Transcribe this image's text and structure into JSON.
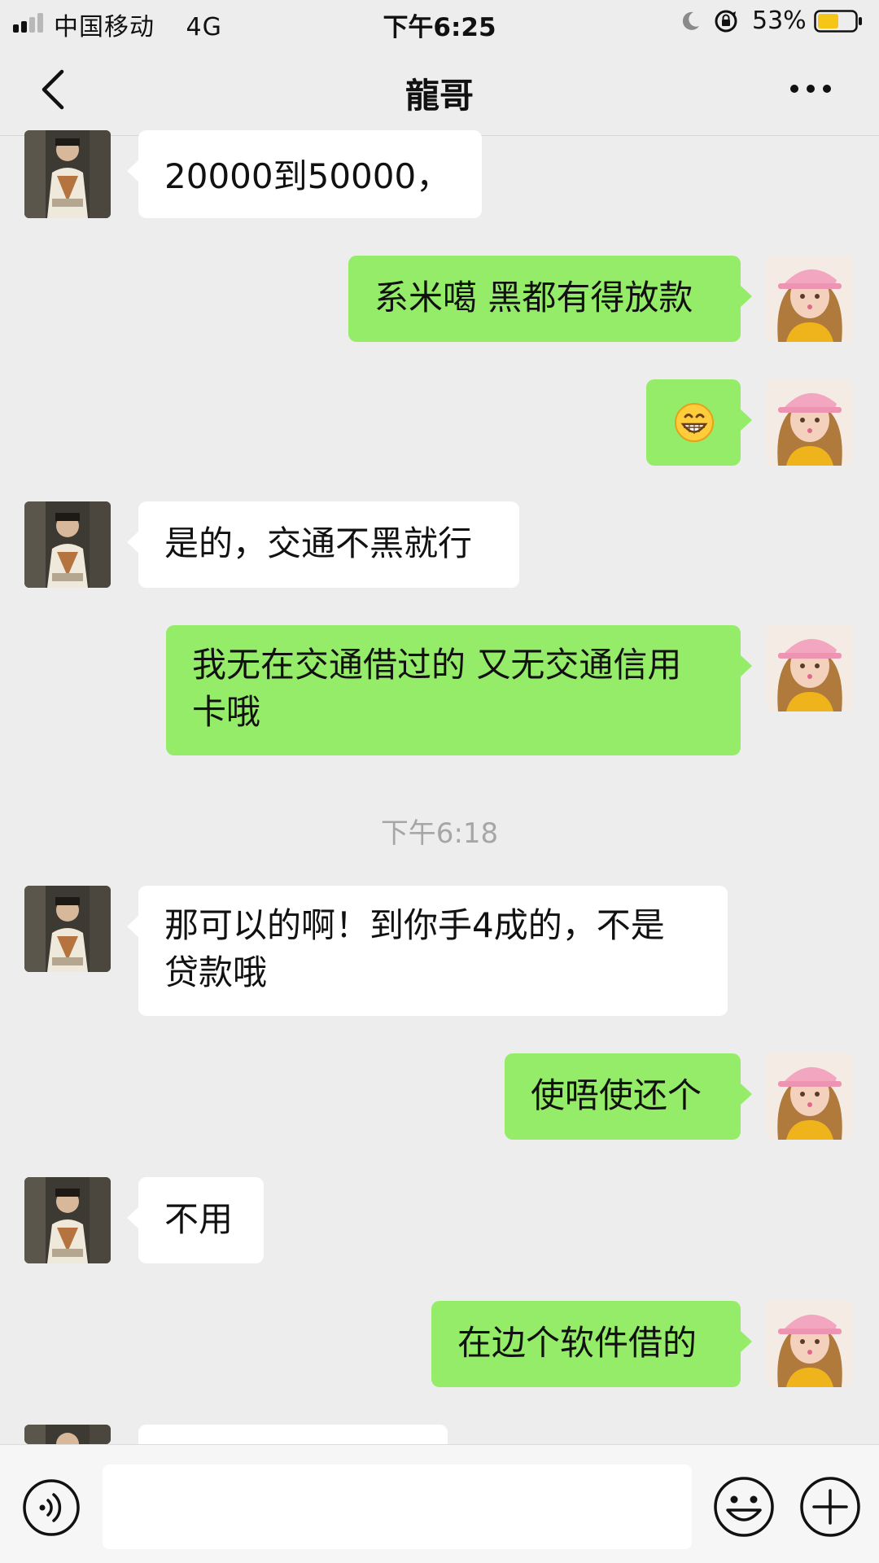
{
  "status_bar": {
    "carrier": "中国移动",
    "network": "4G",
    "time": "下午6:25",
    "battery": "53%"
  },
  "nav": {
    "title": "龍哥"
  },
  "messages": [
    {
      "sender": "contact",
      "text": "20000到50000，"
    },
    {
      "sender": "me",
      "text": "系米噶 黑都有得放款"
    },
    {
      "sender": "me",
      "emoji": "grinning-face"
    },
    {
      "sender": "contact",
      "text": "是的，交通不黑就行"
    },
    {
      "sender": "me",
      "lines": [
        "我无在交通借过的 又无交通信用",
        "卡哦"
      ]
    },
    {
      "sender": "contact",
      "lines": [
        "那可以的啊！到你手4成的，不是",
        "贷款哦"
      ]
    },
    {
      "sender": "me",
      "text": "使唔使还个"
    },
    {
      "sender": "contact",
      "text": "不用"
    },
    {
      "sender": "me",
      "text": "在边个软件借的"
    }
  ],
  "timestamp": "下午6:18",
  "input": {
    "value": ""
  },
  "colors": {
    "background": "#ededed",
    "outgoing_bubble": "#95ec69",
    "incoming_bubble": "#ffffff",
    "battery_fill": "#f5c518"
  },
  "icons": {
    "back": "chevron-left-icon",
    "more": "more-dots-icon",
    "voice": "voice-icon",
    "emoji": "emoji-icon",
    "plus": "plus-icon"
  }
}
